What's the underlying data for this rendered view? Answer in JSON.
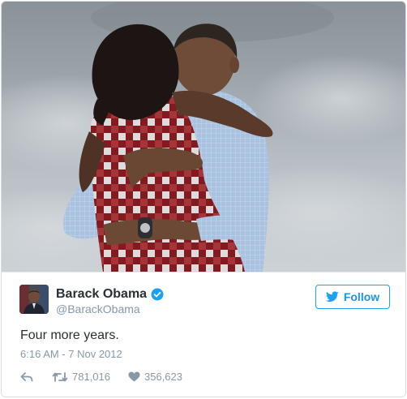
{
  "tweet": {
    "author": {
      "display_name": "Barack Obama",
      "handle": "@BarackObama",
      "verified": true
    },
    "follow_label": "Follow",
    "text": "Four more years.",
    "timestamp": "6:16 AM - 7 Nov 2012",
    "retweet_count": "781,016",
    "like_count": "356,623",
    "photo_icon": "couple-embrace-photo"
  },
  "colors": {
    "accent": "#1da1f2",
    "text": "#292f33",
    "secondary": "#8899a6"
  }
}
